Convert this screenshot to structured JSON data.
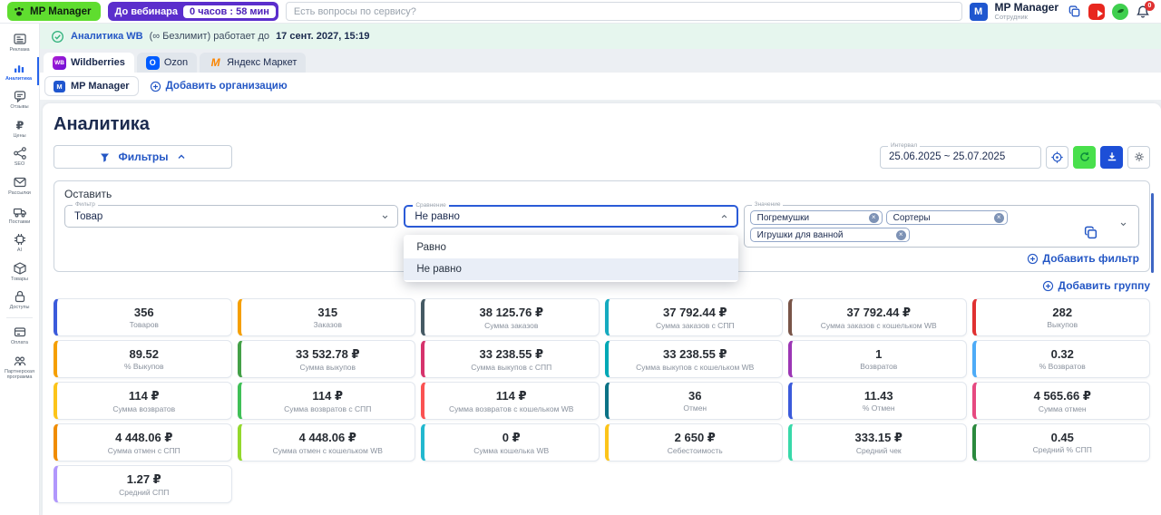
{
  "topbar": {
    "logo_text": "MP Manager",
    "webinar_label": "До вебинара",
    "webinar_timer": "0 часов : 58 мин",
    "search_placeholder": "Есть вопросы по сервису?",
    "user_name": "MP Manager",
    "user_role": "Сотрудник",
    "bell_badge": "0"
  },
  "sidebar": {
    "items": [
      {
        "label": "Реклама",
        "icon": "ads-icon"
      },
      {
        "label": "Аналитика",
        "icon": "analytics-icon",
        "active": true
      },
      {
        "label": "Отзывы",
        "icon": "reviews-icon"
      },
      {
        "label": "Цены",
        "icon": "prices-icon"
      },
      {
        "label": "SEO",
        "icon": "seo-icon"
      },
      {
        "label": "Рассылки",
        "icon": "mail-icon"
      },
      {
        "label": "Поставки",
        "icon": "supplies-icon"
      },
      {
        "label": "AI",
        "icon": "ai-icon"
      },
      {
        "label": "Товары",
        "icon": "products-icon"
      },
      {
        "label": "Доступы",
        "icon": "access-icon"
      },
      {
        "label": "Оплата",
        "icon": "payment-icon",
        "divider_before": true
      },
      {
        "label": "Партнерская программа",
        "icon": "partners-icon"
      }
    ]
  },
  "notice": {
    "product": "Аналитика WB",
    "middle": "(∞ Безлимит) работает до",
    "date": "17 сент. 2027, 15:19"
  },
  "marketplace_tabs": [
    {
      "label": "Wildberries",
      "icon": "wb",
      "active": true
    },
    {
      "label": "Ozon",
      "icon": "oz",
      "active": false
    },
    {
      "label": "Яндекс Маркет",
      "icon": "ym",
      "active": false
    }
  ],
  "org_row": {
    "org_tab": "MP Manager",
    "add_org": "Добавить организацию"
  },
  "page": {
    "title": "Аналитика"
  },
  "toolbar": {
    "filters_label": "Фильтры",
    "interval_label": "Интервал",
    "interval_value": "25.06.2025 ~ 25.07.2025"
  },
  "filter_panel": {
    "keep_label": "Оставить",
    "filter_label": "Фильтр",
    "filter_value": "Товар",
    "compare_label": "Сравнение",
    "compare_value": "Не равно",
    "value_label": "Значение",
    "tags": [
      "Погремушки",
      "Сортеры",
      "Игрушки для ванной"
    ],
    "dropdown_options": [
      {
        "label": "Равно",
        "selected": false
      },
      {
        "label": "Не равно",
        "selected": true
      }
    ],
    "add_filter": "Добавить фильтр",
    "add_group": "Добавить группу"
  },
  "metrics": [
    {
      "value": "356",
      "label": "Товаров",
      "color": "#3b5bdb"
    },
    {
      "value": "315",
      "label": "Заказов",
      "color": "#f59f00"
    },
    {
      "value": "38 125.76 ₽",
      "label": "Сумма заказов",
      "color": "#455a64"
    },
    {
      "value": "37 792.44 ₽",
      "label": "Сумма заказов с СПП",
      "color": "#15aabf"
    },
    {
      "value": "37 792.44 ₽",
      "label": "Сумма заказов с кошельком WB",
      "color": "#795548"
    },
    {
      "value": "282",
      "label": "Выкупов",
      "color": "#e03131"
    },
    {
      "value": "89.52",
      "label": "% Выкупов",
      "color": "#f59f00"
    },
    {
      "value": "33 532.78 ₽",
      "label": "Сумма выкупов",
      "color": "#43a047"
    },
    {
      "value": "33 238.55 ₽",
      "label": "Сумма выкупов с СПП",
      "color": "#d6336c"
    },
    {
      "value": "33 238.55 ₽",
      "label": "Сумма выкупов с кошельком WB",
      "color": "#00a8b5"
    },
    {
      "value": "1",
      "label": "Возвратов",
      "color": "#9c36b5"
    },
    {
      "value": "0.32",
      "label": "% Возвратов",
      "color": "#4dabf7"
    },
    {
      "value": "114 ₽",
      "label": "Сумма возвратов",
      "color": "#fcc419"
    },
    {
      "value": "114 ₽",
      "label": "Сумма возвратов с СПП",
      "color": "#40c057"
    },
    {
      "value": "114 ₽",
      "label": "Сумма возвратов с кошельком WB",
      "color": "#fa5252"
    },
    {
      "value": "36",
      "label": "Отмен",
      "color": "#0b7285"
    },
    {
      "value": "11.43",
      "label": "% Отмен",
      "color": "#3b5bdb"
    },
    {
      "value": "4 565.66 ₽",
      "label": "Сумма отмен",
      "color": "#e64980"
    },
    {
      "value": "4 448.06 ₽",
      "label": "Сумма отмен с СПП",
      "color": "#f08c00"
    },
    {
      "value": "4 448.06 ₽",
      "label": "Сумма отмен с кошельком WB",
      "color": "#94d82d"
    },
    {
      "value": "0 ₽",
      "label": "Сумма кошелька WB",
      "color": "#22b8cf"
    },
    {
      "value": "2 650 ₽",
      "label": "Себестоимость",
      "color": "#fcc419"
    },
    {
      "value": "333.15 ₽",
      "label": "Средний чек",
      "color": "#38d9a9"
    },
    {
      "value": "0.45",
      "label": "Средний % СПП",
      "color": "#2b8a3e"
    },
    {
      "value": "1.27 ₽",
      "label": "Средний СПП",
      "color": "#b197fc"
    }
  ]
}
